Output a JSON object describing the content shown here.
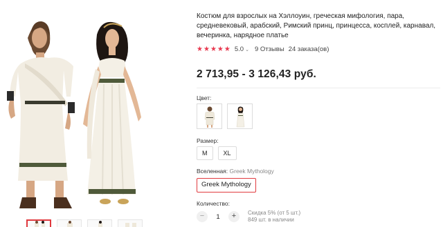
{
  "product": {
    "title": "Костюм для взрослых на Хэллоуин, греческая мифология, пара, средневековый, арабский, Римский принц, принцесса, косплей, карнавал, вечеринка, нарядное платье",
    "rating": "5.0",
    "rating_chevron": "⌄",
    "reviews": "9 Отзывы",
    "orders": "24 заказа(ов)",
    "price": "2 713,95 - 3 126,43 руб.",
    "star_color": "#e8384f",
    "accent_color": "#e0393e"
  },
  "options": {
    "color_label": "Цвет:",
    "size_label": "Размер:",
    "sizes": [
      "M",
      "XL"
    ],
    "universe_label": "Вселенная:",
    "universe_value": "Greek Mythology",
    "universe_selected": "Greek Mythology"
  },
  "quantity": {
    "label": "Количество:",
    "minus": "−",
    "value": "1",
    "plus": "+",
    "discount_text": "Скидка 5% (от 5 шт.)",
    "stock_text": "849 шт. в наличии"
  }
}
